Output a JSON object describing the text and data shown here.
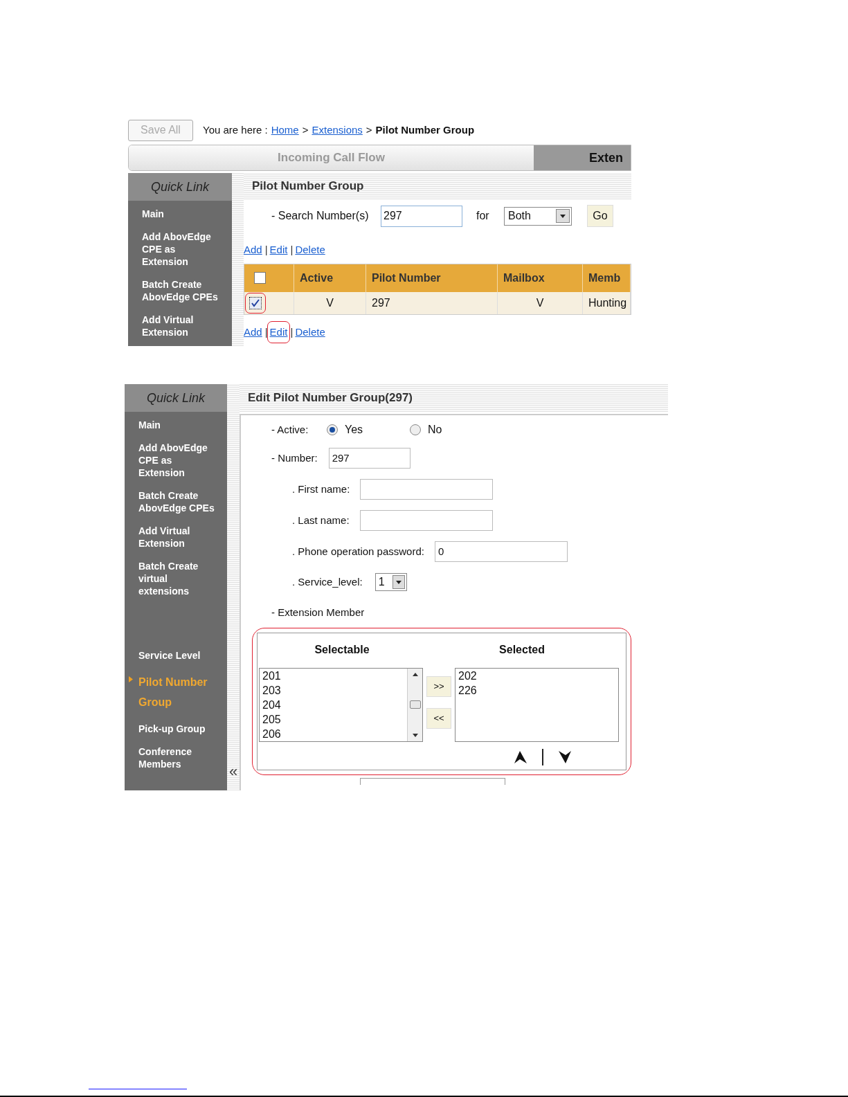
{
  "screen_1": {
    "save_button": "Save All",
    "breadcrumb": {
      "prefix": "You are here :",
      "links": [
        "Home",
        "Extensions"
      ],
      "separator": ">",
      "current": "Pilot Number Group"
    },
    "tabs": [
      {
        "label": "Incoming Call Flow",
        "selected": false
      },
      {
        "label": "Exten",
        "selected": true
      }
    ],
    "sidebar": {
      "title": "Quick Link",
      "items": [
        {
          "label": "Main",
          "selected": false
        },
        {
          "label": "Add AbovEdge CPE as Extension",
          "selected": false
        },
        {
          "label": "Batch Create AbovEdge CPEs",
          "selected": false
        },
        {
          "label": "Add Virtual Extension",
          "selected": false
        }
      ]
    },
    "page_title": "Pilot Number Group",
    "search": {
      "label": "- Search Number(s)",
      "value": "297",
      "for_label": "for",
      "scope": "Both",
      "go_button": "Go"
    },
    "link_separator": "|",
    "actions_top": [
      {
        "label": "Add",
        "highlighted": false
      },
      {
        "label": "Edit",
        "highlighted": false
      },
      {
        "label": "Delete",
        "highlighted": false
      }
    ],
    "table": {
      "header_checked": false,
      "columns": [
        "Active",
        "Pilot Number",
        "Mailbox",
        "Memb"
      ],
      "rows": [
        {
          "checked": true,
          "highlighted": true,
          "cells": [
            "V",
            "297",
            "V",
            "Hunting"
          ]
        }
      ]
    },
    "actions_bottom": [
      {
        "label": "Add",
        "highlighted": false
      },
      {
        "label": "Edit",
        "highlighted": true
      },
      {
        "label": "Delete",
        "highlighted": false
      }
    ]
  },
  "screen_2": {
    "sidebar": {
      "title": "Quick Link",
      "collapse": "«",
      "items": [
        {
          "label": "Main",
          "selected": false
        },
        {
          "label": "Add AbovEdge CPE as Extension",
          "selected": false
        },
        {
          "label": "Batch Create AbovEdge CPEs",
          "selected": false
        },
        {
          "label": "Add Virtual Extension",
          "selected": false
        },
        {
          "label": "Batch Create virtual extensions",
          "selected": false
        },
        {
          "label": "Service Level",
          "selected": false
        },
        {
          "label": "Pilot Number Group",
          "selected": true
        },
        {
          "label": "Pick-up Group",
          "selected": false
        },
        {
          "label": "Conference Members",
          "selected": false
        }
      ]
    },
    "page_title": "Edit Pilot Number Group(297)",
    "active": {
      "label": "- Active:",
      "options": [
        {
          "label": "Yes",
          "selected": true
        },
        {
          "label": "No",
          "selected": false
        }
      ]
    },
    "number": {
      "label": "- Number:",
      "value": "297"
    },
    "fields": [
      {
        "label": ". First name:"
      },
      {
        "label": ". Last name:"
      },
      {
        "label": ". Phone operation password:",
        "value": "0"
      }
    ],
    "service_level": {
      "label": ". Service_level:",
      "value": "1"
    },
    "extension_member": {
      "label": "- Extension Member",
      "highlighted": true,
      "selectable_title": "Selectable",
      "selectable": [
        "201",
        "203",
        "204",
        "205",
        "206"
      ],
      "selected_title": "Selected",
      "selected": [
        "202",
        "226"
      ],
      "add_button": ">>",
      "remove_button": "<<"
    }
  }
}
